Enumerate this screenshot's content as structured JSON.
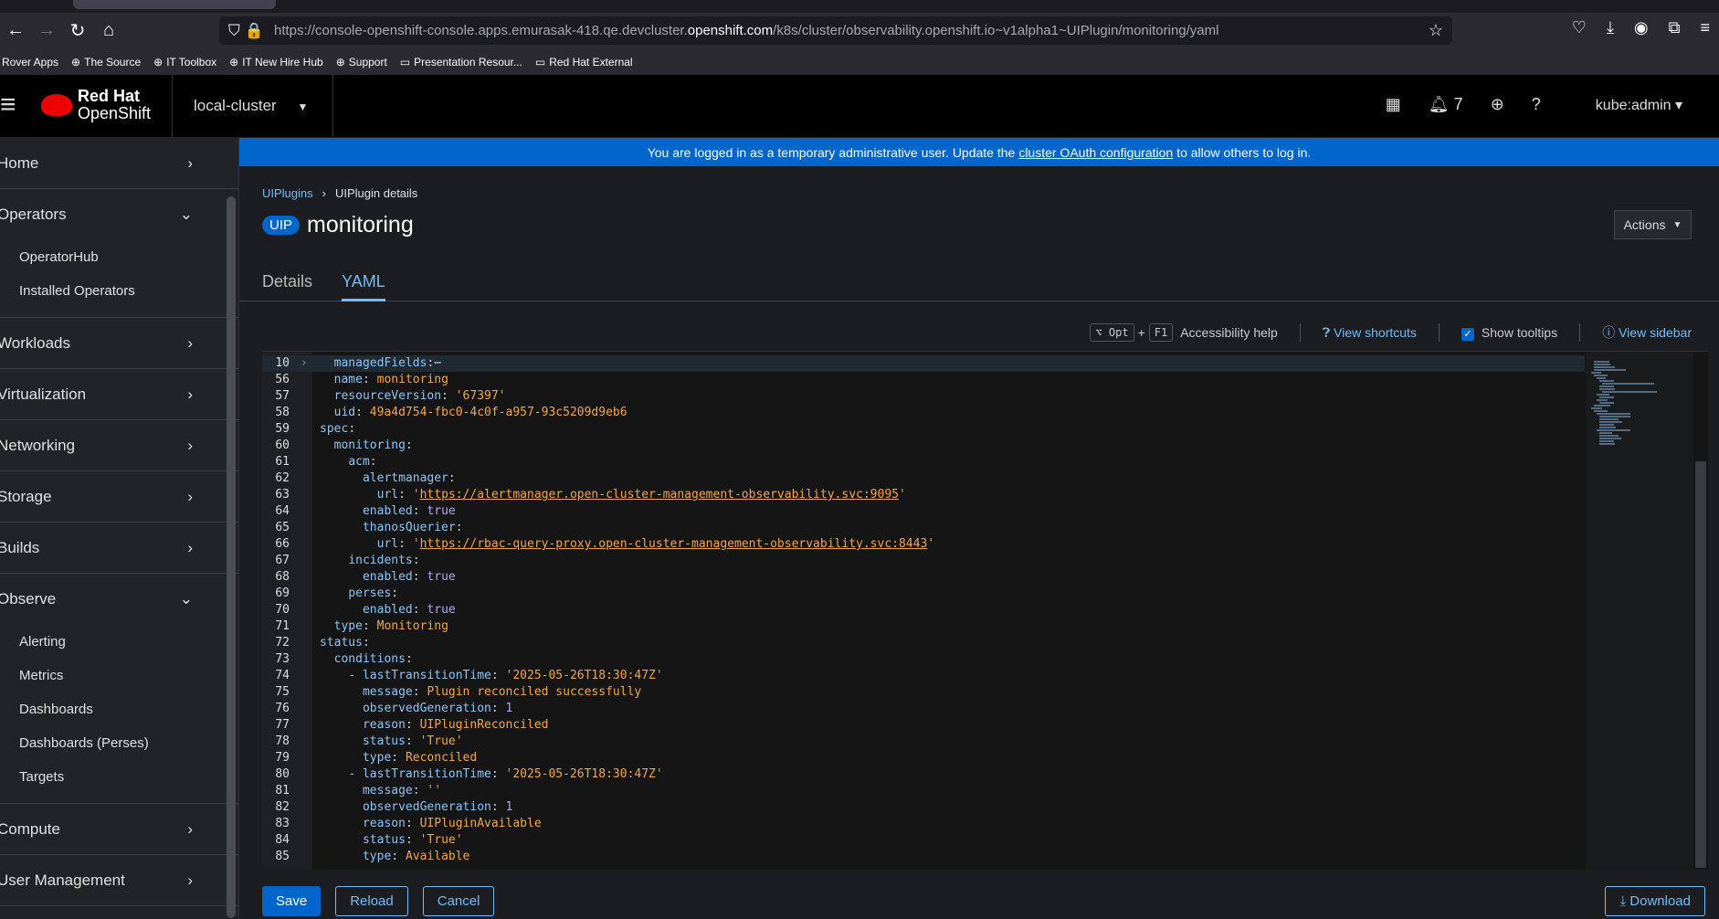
{
  "browser": {
    "url_pre": "https://console-openshift-console.apps.emurasak-418.qe.devcluster.",
    "url_host": "openshift.com",
    "url_post": "/k8s/cluster/observability.openshift.io~v1alpha1~UIPlugin/monitoring/yaml",
    "bookmarks": [
      "Rover Apps",
      "The Source",
      "IT Toolbox",
      "IT New Hire Hub",
      "Support",
      "Presentation Resour...",
      "Red Hat External"
    ]
  },
  "masthead": {
    "brand_line1": "Red Hat",
    "brand_line2": "OpenShift",
    "cluster": "local-cluster",
    "notifications": "7",
    "user": "kube:admin"
  },
  "sidebar": {
    "home": "Home",
    "operators": "Operators",
    "operatorhub": "OperatorHub",
    "installed_operators": "Installed Operators",
    "workloads": "Workloads",
    "virtualization": "Virtualization",
    "networking": "Networking",
    "storage": "Storage",
    "builds": "Builds",
    "observe": "Observe",
    "alerting": "Alerting",
    "metrics": "Metrics",
    "dashboards": "Dashboards",
    "dashboards_perses": "Dashboards (Perses)",
    "targets": "Targets",
    "compute": "Compute",
    "user_management": "User Management"
  },
  "banner": {
    "pre": "You are logged in as a temporary administrative user. Update the",
    "link": "cluster OAuth configuration",
    "post": "to allow others to log in."
  },
  "breadcrumb": {
    "parent": "UIPlugins",
    "current": "UIPlugin details"
  },
  "title": {
    "badge": "UIP",
    "name": "monitoring",
    "actions": "Actions"
  },
  "tabs": [
    "Details",
    "YAML"
  ],
  "editor_toolbar": {
    "key1": "⌥ Opt",
    "plus": "+",
    "key2": "F1",
    "a11y": "Accessibility help",
    "shortcuts": "View shortcuts",
    "tooltips": "Show tooltips",
    "sidebar": "View sidebar"
  },
  "yaml_lines": [
    {
      "n": "10",
      "i": 1,
      "k": "managedFields",
      "v": "",
      "t": "ellipsis",
      "cur": true
    },
    {
      "n": "56",
      "i": 1,
      "k": "name",
      "v": "monitoring",
      "t": "v"
    },
    {
      "n": "57",
      "i": 1,
      "k": "resourceVersion",
      "v": "'67397'",
      "t": "v"
    },
    {
      "n": "58",
      "i": 1,
      "k": "uid",
      "v": "49a4d754-fbc0-4c0f-a957-93c5209d9eb6",
      "t": "v"
    },
    {
      "n": "59",
      "i": 0,
      "k": "spec",
      "v": "",
      "t": ""
    },
    {
      "n": "60",
      "i": 1,
      "k": "monitoring",
      "v": "",
      "t": ""
    },
    {
      "n": "61",
      "i": 2,
      "k": "acm",
      "v": "",
      "t": ""
    },
    {
      "n": "62",
      "i": 3,
      "k": "alertmanager",
      "v": "",
      "t": ""
    },
    {
      "n": "63",
      "i": 4,
      "k": "url",
      "v": "https://alertmanager.open-cluster-management-observability.svc:9095",
      "t": "u"
    },
    {
      "n": "64",
      "i": 3,
      "k": "enabled",
      "v": "true",
      "t": "b"
    },
    {
      "n": "65",
      "i": 3,
      "k": "thanosQuerier",
      "v": "",
      "t": ""
    },
    {
      "n": "66",
      "i": 4,
      "k": "url",
      "v": "https://rbac-query-proxy.open-cluster-management-observability.svc:8443",
      "t": "u"
    },
    {
      "n": "67",
      "i": 2,
      "k": "incidents",
      "v": "",
      "t": ""
    },
    {
      "n": "68",
      "i": 3,
      "k": "enabled",
      "v": "true",
      "t": "b"
    },
    {
      "n": "69",
      "i": 2,
      "k": "perses",
      "v": "",
      "t": ""
    },
    {
      "n": "70",
      "i": 3,
      "k": "enabled",
      "v": "true",
      "t": "b"
    },
    {
      "n": "71",
      "i": 1,
      "k": "type",
      "v": "Monitoring",
      "t": "v"
    },
    {
      "n": "72",
      "i": 0,
      "k": "status",
      "v": "",
      "t": ""
    },
    {
      "n": "73",
      "i": 1,
      "k": "conditions",
      "v": "",
      "t": ""
    },
    {
      "n": "74",
      "i": 2,
      "k": "- lastTransitionTime",
      "v": "'2025-05-26T18:30:47Z'",
      "t": "v"
    },
    {
      "n": "75",
      "i": 3,
      "k": "message",
      "v": "Plugin reconciled successfully",
      "t": "v"
    },
    {
      "n": "76",
      "i": 3,
      "k": "observedGeneration",
      "v": "1",
      "t": "b"
    },
    {
      "n": "77",
      "i": 3,
      "k": "reason",
      "v": "UIPluginReconciled",
      "t": "v"
    },
    {
      "n": "78",
      "i": 3,
      "k": "status",
      "v": "'True'",
      "t": "v"
    },
    {
      "n": "79",
      "i": 3,
      "k": "type",
      "v": "Reconciled",
      "t": "v"
    },
    {
      "n": "80",
      "i": 2,
      "k": "- lastTransitionTime",
      "v": "'2025-05-26T18:30:47Z'",
      "t": "v"
    },
    {
      "n": "81",
      "i": 3,
      "k": "message",
      "v": "''",
      "t": "v"
    },
    {
      "n": "82",
      "i": 3,
      "k": "observedGeneration",
      "v": "1",
      "t": "b"
    },
    {
      "n": "83",
      "i": 3,
      "k": "reason",
      "v": "UIPluginAvailable",
      "t": "v"
    },
    {
      "n": "84",
      "i": 3,
      "k": "status",
      "v": "'True'",
      "t": "v"
    },
    {
      "n": "85",
      "i": 3,
      "k": "type",
      "v": "Available",
      "t": "v"
    }
  ],
  "buttons": {
    "save": "Save",
    "reload": "Reload",
    "cancel": "Cancel",
    "download": "Download"
  }
}
